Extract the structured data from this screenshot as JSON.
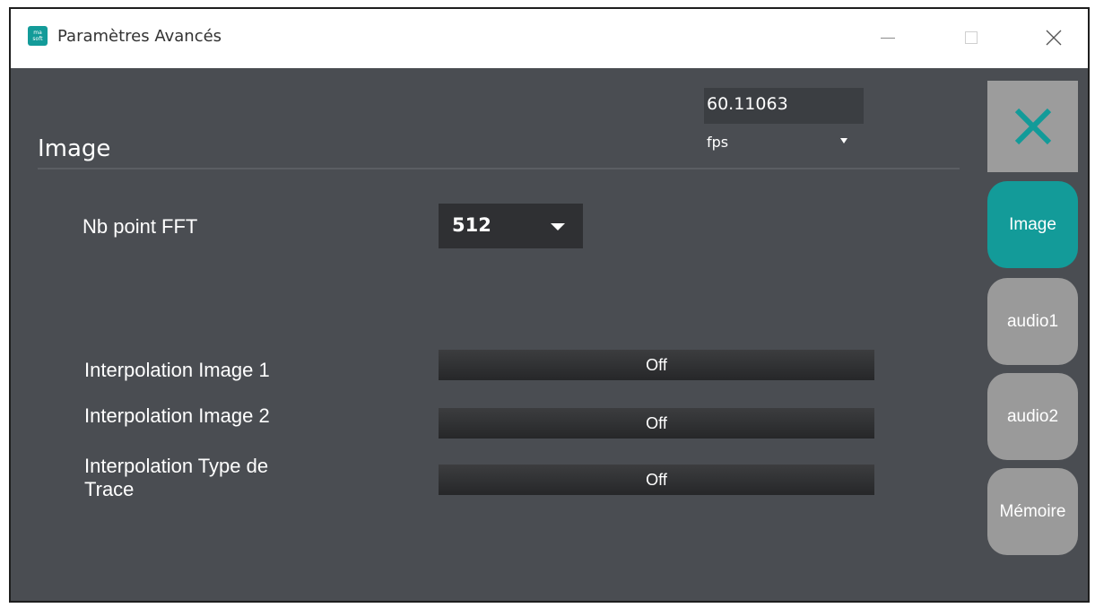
{
  "window": {
    "title": "Paramètres Avancés",
    "app_icon_text": "ma\nsoft"
  },
  "header": {
    "section_title": "Image",
    "fps_value": "60.11063",
    "fps_unit": "fps"
  },
  "settings": {
    "fft_label": "Nb point FFT",
    "fft_value": "512",
    "interp1_label": "Interpolation Image 1",
    "interp1_value": "Off",
    "interp2_label": "Interpolation Image 2",
    "interp2_value": "Off",
    "interp_trace_label_line1": "Interpolation Type de",
    "interp_trace_label_line2": "Trace",
    "interp_trace_value": "Off"
  },
  "sidebar": {
    "tabs": [
      {
        "label": "Image",
        "active": true
      },
      {
        "label": "audio1",
        "active": false
      },
      {
        "label": "audio2",
        "active": false
      },
      {
        "label": "Mémoire",
        "active": false
      }
    ]
  },
  "colors": {
    "accent": "#139b99",
    "panel_bg": "#4a4d52",
    "tab_inactive": "#9a9a9a",
    "close_icon": "#139b99"
  },
  "icons": {
    "app": "app-logo-icon",
    "minimize": "minimize-icon",
    "maximize": "maximize-icon",
    "close_window": "close-icon",
    "close_panel": "close-panel-icon"
  }
}
